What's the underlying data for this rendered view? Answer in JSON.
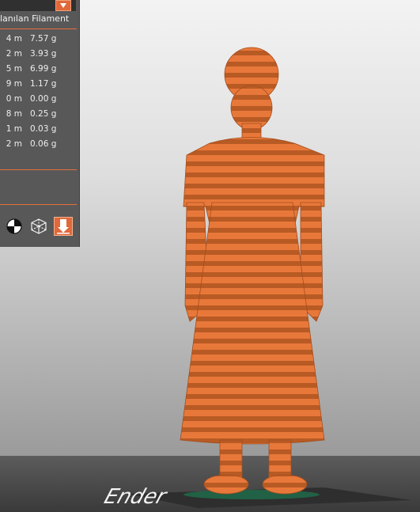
{
  "filament_panel": {
    "header_label": "lanılan Filament",
    "rows": [
      {
        "length": "4 m",
        "weight": "7.57 g"
      },
      {
        "length": "2 m",
        "weight": "3.93 g"
      },
      {
        "length": "5 m",
        "weight": "6.99 g"
      },
      {
        "length": "9 m",
        "weight": "1.17 g"
      },
      {
        "length": "0 m",
        "weight": "0.00 g"
      },
      {
        "length": "8 m",
        "weight": "0.25 g"
      },
      {
        "length": "1 m",
        "weight": "0.03 g"
      },
      {
        "length": "2 m",
        "weight": "0.06 g"
      }
    ],
    "view_icons": [
      "color-scheme-icon",
      "wireframe-cube-icon",
      "layer-slice-icon"
    ]
  },
  "colors": {
    "accent": "#e0683a",
    "panel": "#585858",
    "model": "#e87a3a"
  },
  "plate_logo_text": "Ender"
}
